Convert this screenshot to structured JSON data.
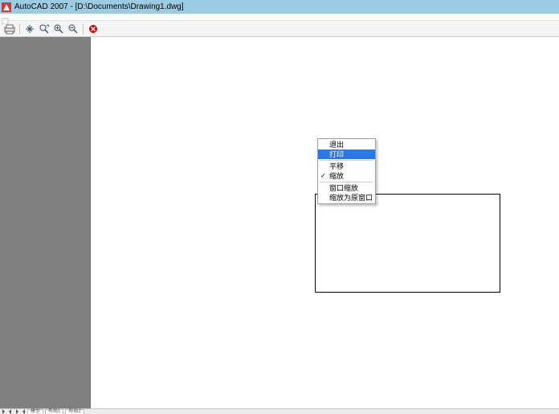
{
  "window": {
    "title": "AutoCAD 2007 - [D:\\Documents\\Drawing1.dwg]"
  },
  "toolbar": {
    "icons": {
      "plot": "plot-icon",
      "pan": "pan-icon",
      "zoom_realtime": "zoom-realtime-icon",
      "zoom_in": "zoom-in-icon",
      "zoom_out": "zoom-out-icon",
      "close": "close-icon"
    }
  },
  "context_menu": {
    "items": [
      {
        "label": "退出",
        "selected": false,
        "checked": false
      },
      {
        "label": "打印",
        "selected": true,
        "checked": false
      },
      {
        "divider": true
      },
      {
        "label": "平移",
        "selected": false,
        "checked": false
      },
      {
        "label": "缩放",
        "selected": false,
        "checked": true
      },
      {
        "divider": true
      },
      {
        "label": "窗口缩放",
        "selected": false,
        "checked": false
      },
      {
        "label": "缩放为原窗口",
        "selected": false,
        "checked": false
      }
    ]
  },
  "statusbar": {
    "model_tab": "模型",
    "layout1": "布局1",
    "layout2": "布局2"
  }
}
